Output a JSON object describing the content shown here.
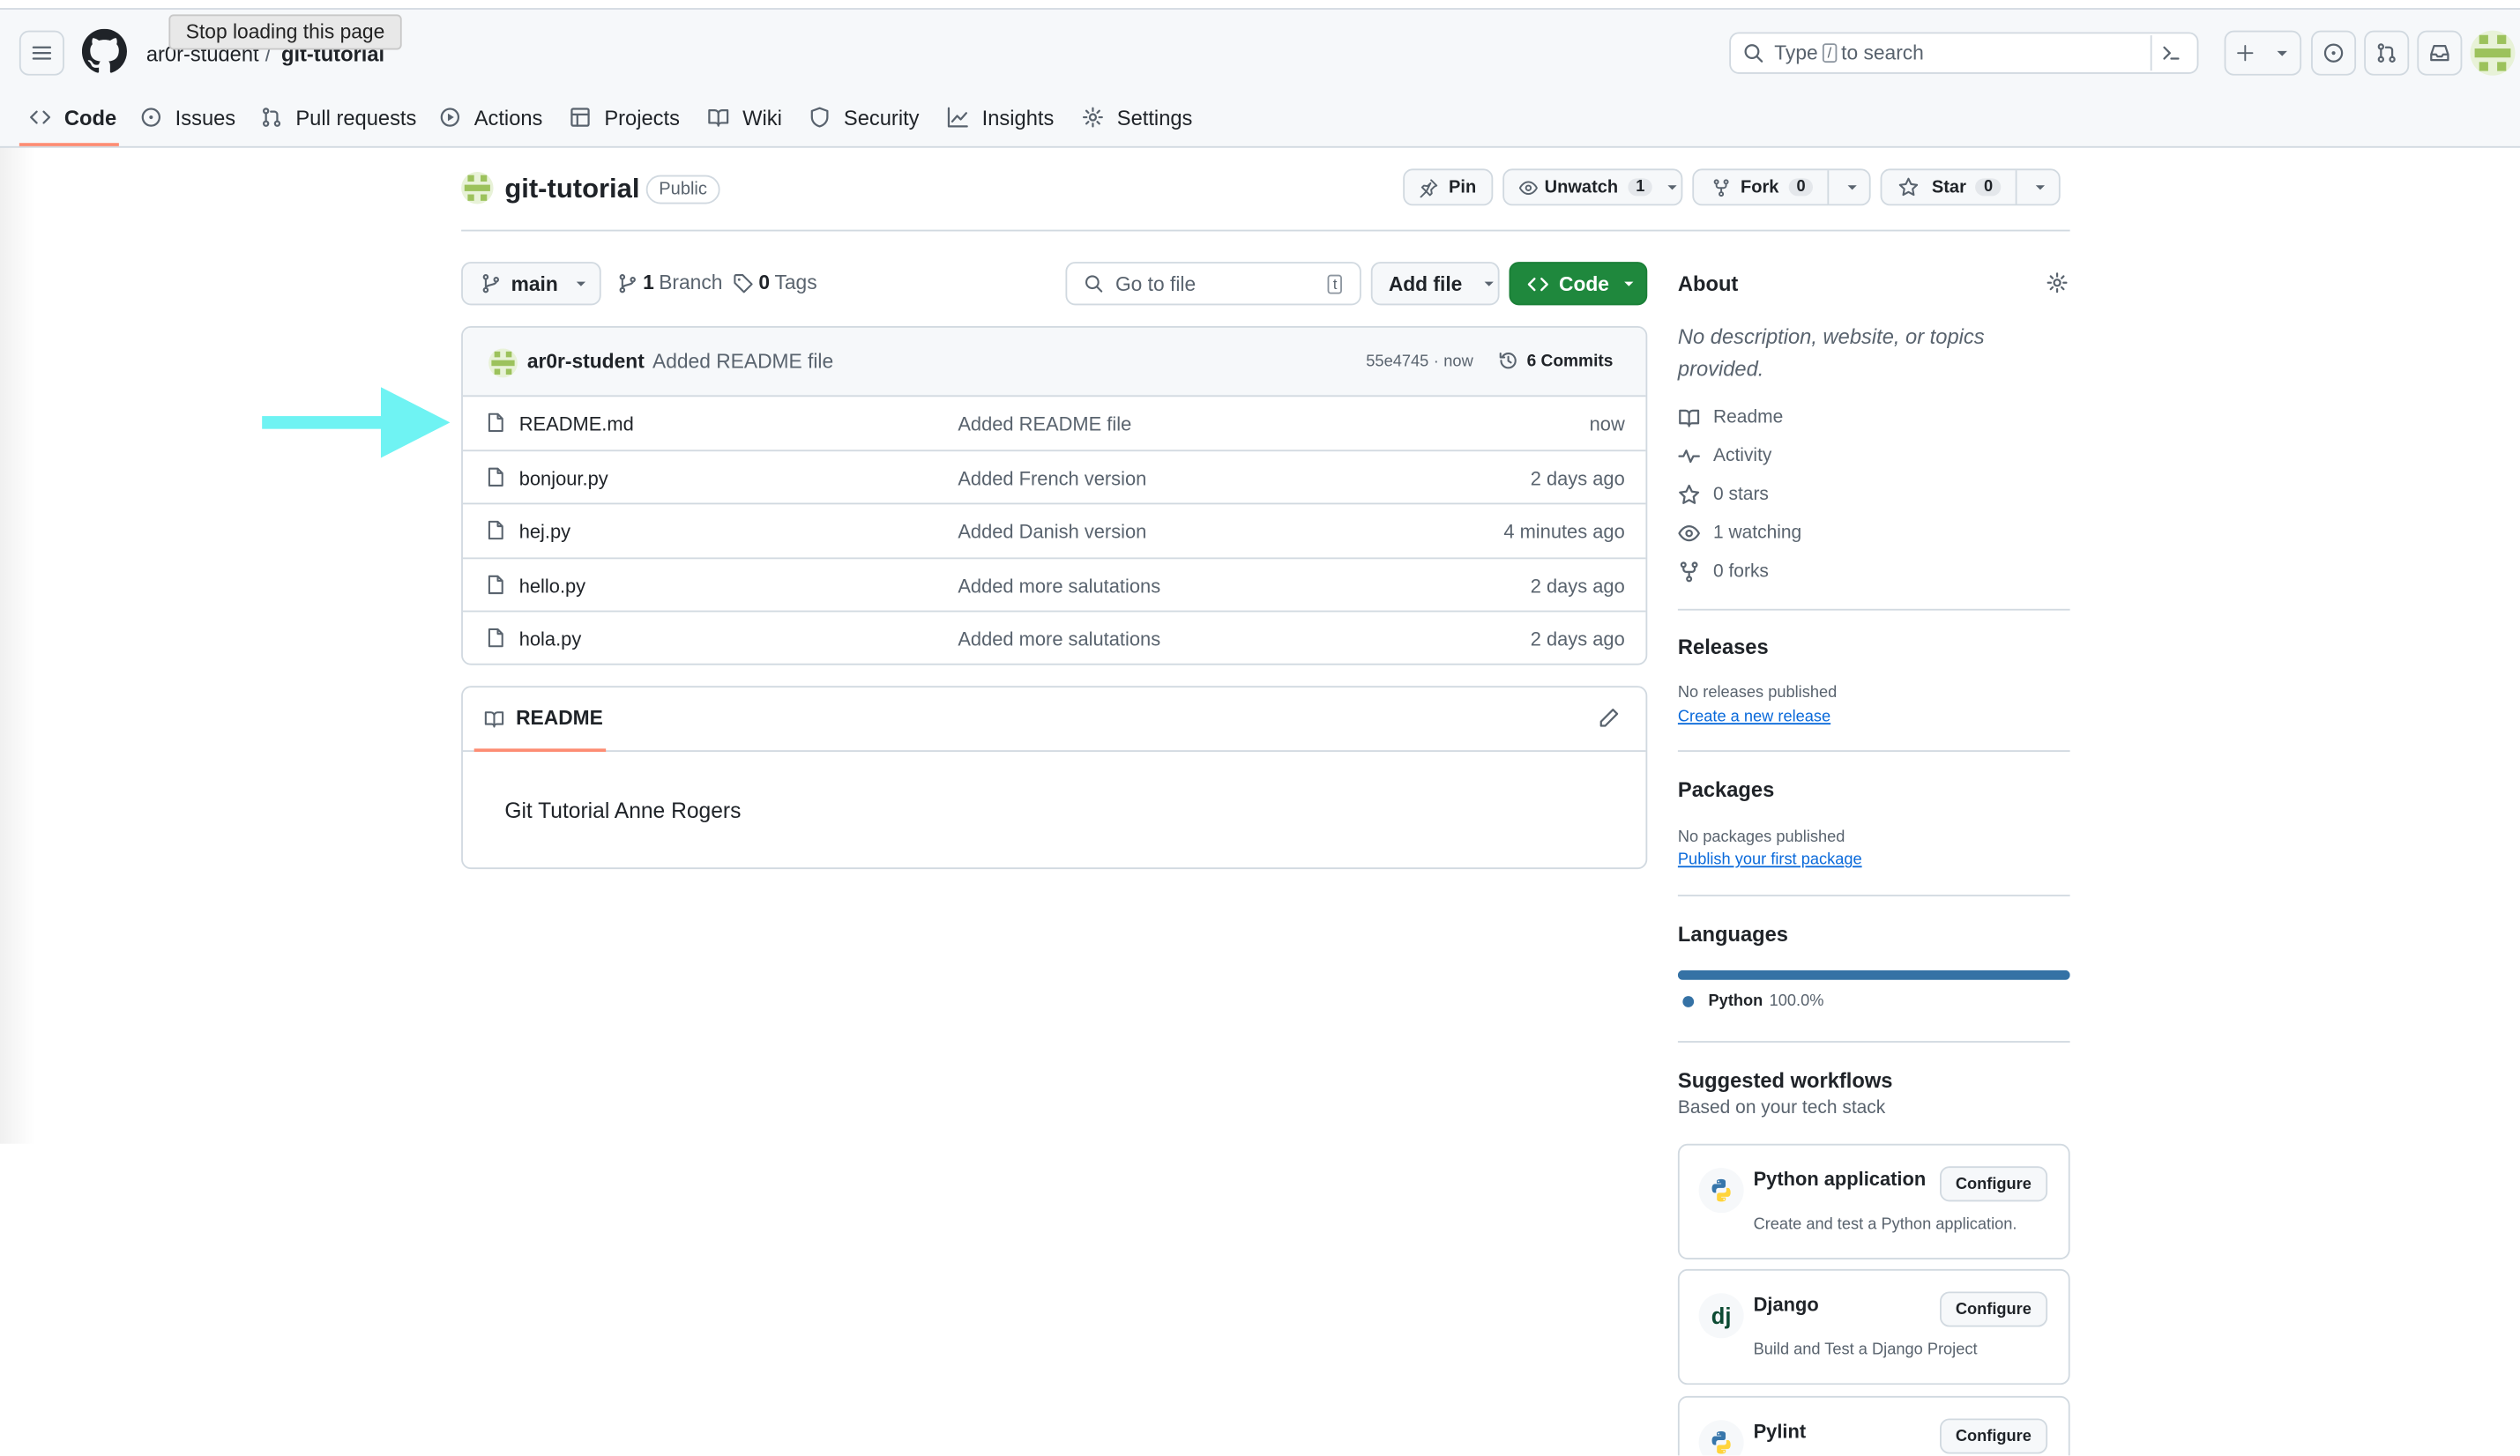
{
  "tooltip": "Stop loading this page",
  "breadcrumb": {
    "owner": "ar0r-student",
    "separator": "/",
    "repo": "git-tutorial"
  },
  "search": {
    "prefix": "Type",
    "key": "/",
    "suffix": "to search"
  },
  "tabs": [
    {
      "label": "Code",
      "icon": "code-icon"
    },
    {
      "label": "Issues",
      "icon": "issue-icon"
    },
    {
      "label": "Pull requests",
      "icon": "pull-request-icon"
    },
    {
      "label": "Actions",
      "icon": "play-icon"
    },
    {
      "label": "Projects",
      "icon": "table-icon"
    },
    {
      "label": "Wiki",
      "icon": "book-icon"
    },
    {
      "label": "Security",
      "icon": "shield-icon"
    },
    {
      "label": "Insights",
      "icon": "graph-icon"
    },
    {
      "label": "Settings",
      "icon": "gear-icon"
    }
  ],
  "repo": {
    "name": "git-tutorial",
    "visibility": "Public"
  },
  "actions": {
    "pin": "Pin",
    "unwatch": "Unwatch",
    "watch_count": "1",
    "fork": "Fork",
    "fork_count": "0",
    "star": "Star",
    "star_count": "0"
  },
  "branch": {
    "name": "main",
    "branches_count": "1",
    "branches_label": "Branch",
    "tags_count": "0",
    "tags_label": "Tags"
  },
  "goto_file": {
    "placeholder": "Go to file",
    "shortcut": "t"
  },
  "add_file": "Add file",
  "code_button": "Code",
  "commit": {
    "author": "ar0r-student",
    "message": "Added README file",
    "hash": "55e4745",
    "sep": "·",
    "time": "now",
    "commits": "6 Commits"
  },
  "files": [
    {
      "name": "README.md",
      "message": "Added README file",
      "time": "now"
    },
    {
      "name": "bonjour.py",
      "message": "Added French version",
      "time": "2 days ago"
    },
    {
      "name": "hej.py",
      "message": "Added Danish version",
      "time": "4 minutes ago"
    },
    {
      "name": "hello.py",
      "message": "Added more salutations",
      "time": "2 days ago"
    },
    {
      "name": "hola.py",
      "message": "Added more salutations",
      "time": "2 days ago"
    }
  ],
  "readme": {
    "tab": "README",
    "content": "Git Tutorial Anne Rogers"
  },
  "about": {
    "title": "About",
    "description": "No description, website, or topics provided.",
    "items": [
      {
        "label": "Readme",
        "icon": "book-icon"
      },
      {
        "label": "Activity",
        "icon": "pulse-icon"
      },
      {
        "label": "0 stars",
        "icon": "star-icon"
      },
      {
        "label": "1 watching",
        "icon": "eye-icon"
      },
      {
        "label": "0 forks",
        "icon": "fork-icon"
      }
    ]
  },
  "releases": {
    "title": "Releases",
    "text": "No releases published",
    "link": "Create a new release"
  },
  "packages": {
    "title": "Packages",
    "text": "No packages published",
    "link": "Publish your first package"
  },
  "languages": {
    "title": "Languages",
    "items": [
      {
        "name": "Python",
        "percent": "100.0%",
        "fraction": 1.0,
        "color": "#3572A5"
      }
    ]
  },
  "workflows": {
    "title": "Suggested workflows",
    "subtitle": "Based on your tech stack",
    "items": [
      {
        "name": "Python application",
        "desc": "Create and test a Python application.",
        "button": "Configure",
        "icon": "python-icon"
      },
      {
        "name": "Django",
        "desc": "Build and Test a Django Project",
        "button": "Configure",
        "icon": "django-icon"
      },
      {
        "name": "Pylint",
        "desc": "",
        "button": "Configure",
        "icon": "python-icon"
      }
    ]
  },
  "colors": {
    "accent_tab": "#fd8c73",
    "code_button": "#1f883d",
    "annotation_arrow": "#6ff3f3",
    "link": "#0969da"
  }
}
